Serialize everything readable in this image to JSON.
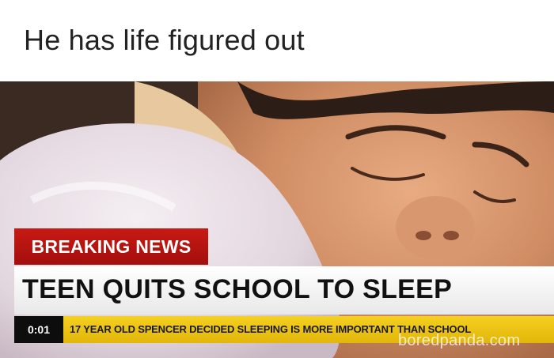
{
  "caption": "He has life figured out",
  "overlay": {
    "breaking_label": "BREAKING NEWS",
    "headline": "TEEN QUITS SCHOOL TO SLEEP",
    "timestamp": "0:01",
    "ticker": "17 YEAR OLD SPENCER DECIDED SLEEPING IS MORE IMPORTANT THAN SCHOOL"
  },
  "watermark": "boredpanda.com",
  "colors": {
    "breaking_red": "#b8140f",
    "ticker_yellow": "#f0c814",
    "headline_bg": "#ffffff",
    "time_bg": "#0d0d0d"
  }
}
